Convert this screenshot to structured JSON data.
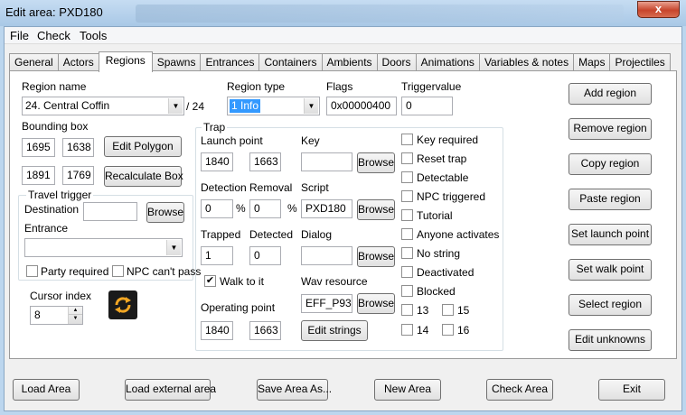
{
  "window": {
    "title": "Edit area: PXD180",
    "close_glyph": "x"
  },
  "menu": [
    "File",
    "Check",
    "Tools"
  ],
  "tabs": [
    "General",
    "Actors",
    "Regions",
    "Spawns",
    "Entrances",
    "Containers",
    "Ambients",
    "Doors",
    "Animations",
    "Variables & notes",
    "Maps",
    "Projectiles"
  ],
  "active_tab": "Regions",
  "region": {
    "name_label": "Region name",
    "name_value": "24. Central Coffin",
    "count": "/ 24",
    "type_label": "Region type",
    "type_value": "1 Info",
    "flags_label": "Flags",
    "flags_value": "0x00000400",
    "triggervalue_label": "Triggervalue",
    "triggervalue_value": "0"
  },
  "bounding_box": {
    "label": "Bounding box",
    "x1": "1695",
    "y1": "1638",
    "x2": "1891",
    "y2": "1769",
    "edit_polygon": "Edit Polygon",
    "recalculate": "Recalculate Box"
  },
  "travel_trigger": {
    "title": "Travel trigger",
    "destination_label": "Destination",
    "destination_value": "",
    "browse": "Browse",
    "entrance_label": "Entrance",
    "entrance_value": "",
    "party_required": "Party required",
    "npc_cant_pass": "NPC can't pass"
  },
  "cursor": {
    "label": "Cursor index",
    "value": "8",
    "icon": "circular-arrows-icon"
  },
  "trap": {
    "title": "Trap",
    "launch_point_label": "Launch point",
    "launch_x": "1840",
    "launch_y": "1663",
    "key_label": "Key",
    "key_value": "",
    "detection_label": "Detection",
    "detection_value": "0",
    "removal_label": "Removal",
    "removal_value": "0",
    "percent": "%",
    "script_label": "Script",
    "script_value": "PXD180",
    "trapped_label": "Trapped",
    "trapped_value": "1",
    "detected_label": "Detected",
    "detected_value": "0",
    "dialog_label": "Dialog",
    "dialog_value": "",
    "walk_to_it": "Walk to it",
    "wav_label": "Wav resource",
    "wav_value": "EFF_P93",
    "operating_point_label": "Operating point",
    "op_x": "1840",
    "op_y": "1663",
    "edit_strings": "Edit strings",
    "browse": "Browse"
  },
  "flag_checks": {
    "key_required": "Key required",
    "reset_trap": "Reset trap",
    "detectable": "Detectable",
    "npc_triggered": "NPC triggered",
    "tutorial": "Tutorial",
    "anyone_activates": "Anyone activates",
    "no_string": "No string",
    "deactivated": "Deactivated",
    "blocked": "Blocked",
    "b13": "13",
    "b15": "15",
    "b14": "14",
    "b16": "16"
  },
  "side_buttons": [
    "Add region",
    "Remove region",
    "Copy region",
    "Paste region",
    "Set launch point",
    "Set walk point",
    "Select region",
    "Edit unknowns"
  ],
  "bottom_buttons": [
    "Load Area",
    "Load external area",
    "Save Area As...",
    "New Area",
    "Check Area",
    "Exit"
  ],
  "check_mark": "✔"
}
